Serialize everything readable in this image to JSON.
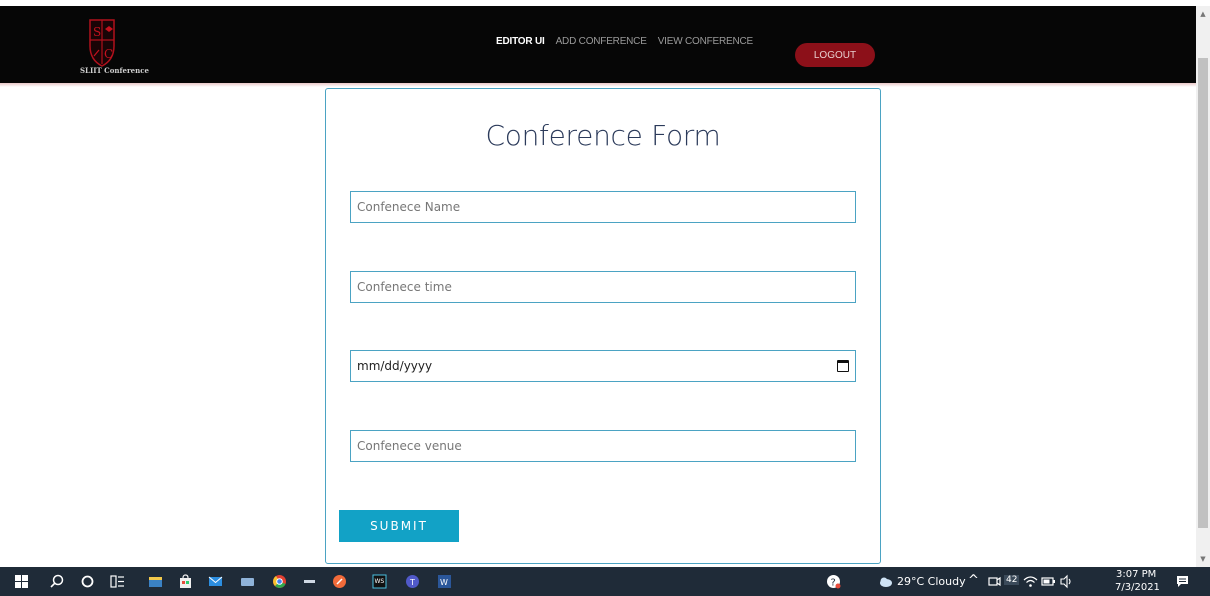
{
  "navbar": {
    "logo_caption": "SLIIT Conference",
    "links": [
      "EDITOR UI",
      "ADD CONFERENCE",
      "VIEW CONFERENCE"
    ],
    "logout_label": "LOGOUT"
  },
  "form": {
    "title": "Conference Form",
    "name_placeholder": "Confenece Name",
    "time_placeholder": "Confenece time",
    "date_placeholder": "mm/dd/yyyy",
    "venue_placeholder": "Confenece venue",
    "submit_label": "SUBMIT"
  },
  "taskbar": {
    "weather": "29°C  Cloudy",
    "notification_count": "42",
    "time": "3:07 PM",
    "date": "7/3/2021"
  }
}
